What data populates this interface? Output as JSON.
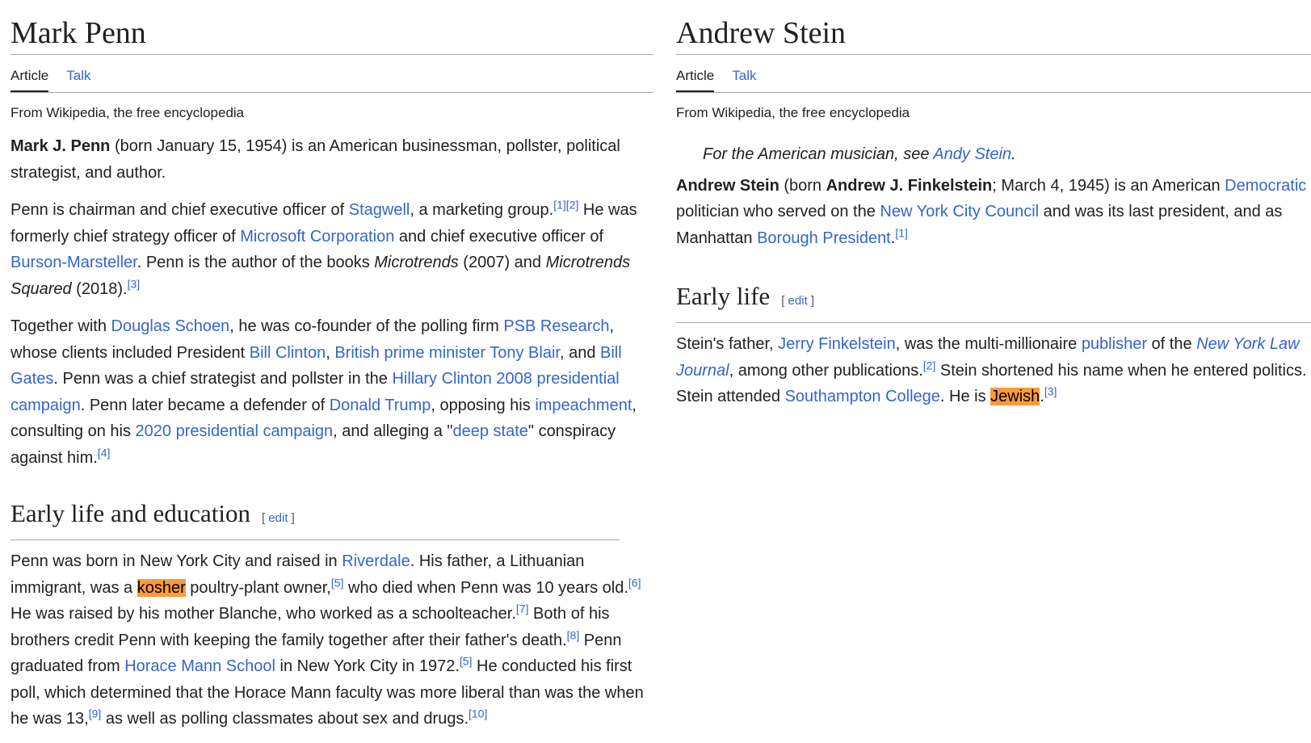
{
  "left": {
    "title": "Mark Penn",
    "tab_article": "Article",
    "tab_talk": "Talk",
    "from": "From Wikipedia, the free encyclopedia",
    "section_title": "Early life and education",
    "edit": "edit"
  },
  "right": {
    "title": "Andrew Stein",
    "tab_article": "Article",
    "tab_talk": "Talk",
    "from": "From Wikipedia, the free encyclopedia",
    "section_title": "Early life",
    "edit": "edit"
  },
  "colors": {
    "link": "#3366cc",
    "highlight": "#ff9a3a",
    "text": "#202122"
  }
}
